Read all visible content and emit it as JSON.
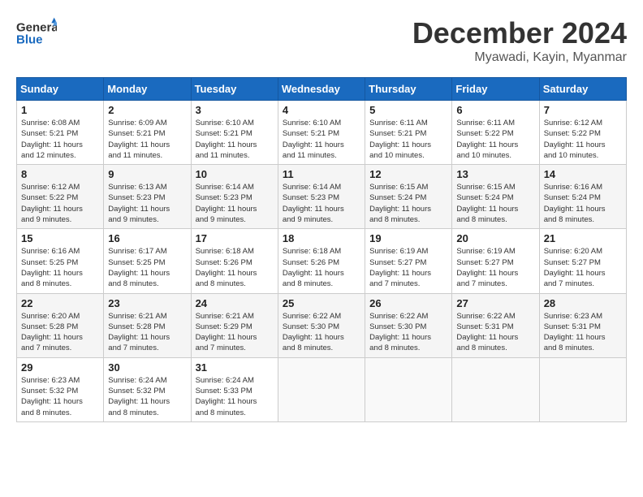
{
  "header": {
    "logo_line1": "General",
    "logo_line2": "Blue",
    "month": "December 2024",
    "location": "Myawadi, Kayin, Myanmar"
  },
  "days_of_week": [
    "Sunday",
    "Monday",
    "Tuesday",
    "Wednesday",
    "Thursday",
    "Friday",
    "Saturday"
  ],
  "weeks": [
    [
      {
        "day": 1,
        "info": "Sunrise: 6:08 AM\nSunset: 5:21 PM\nDaylight: 11 hours\nand 12 minutes."
      },
      {
        "day": 2,
        "info": "Sunrise: 6:09 AM\nSunset: 5:21 PM\nDaylight: 11 hours\nand 11 minutes."
      },
      {
        "day": 3,
        "info": "Sunrise: 6:10 AM\nSunset: 5:21 PM\nDaylight: 11 hours\nand 11 minutes."
      },
      {
        "day": 4,
        "info": "Sunrise: 6:10 AM\nSunset: 5:21 PM\nDaylight: 11 hours\nand 11 minutes."
      },
      {
        "day": 5,
        "info": "Sunrise: 6:11 AM\nSunset: 5:21 PM\nDaylight: 11 hours\nand 10 minutes."
      },
      {
        "day": 6,
        "info": "Sunrise: 6:11 AM\nSunset: 5:22 PM\nDaylight: 11 hours\nand 10 minutes."
      },
      {
        "day": 7,
        "info": "Sunrise: 6:12 AM\nSunset: 5:22 PM\nDaylight: 11 hours\nand 10 minutes."
      }
    ],
    [
      {
        "day": 8,
        "info": "Sunrise: 6:12 AM\nSunset: 5:22 PM\nDaylight: 11 hours\nand 9 minutes."
      },
      {
        "day": 9,
        "info": "Sunrise: 6:13 AM\nSunset: 5:23 PM\nDaylight: 11 hours\nand 9 minutes."
      },
      {
        "day": 10,
        "info": "Sunrise: 6:14 AM\nSunset: 5:23 PM\nDaylight: 11 hours\nand 9 minutes."
      },
      {
        "day": 11,
        "info": "Sunrise: 6:14 AM\nSunset: 5:23 PM\nDaylight: 11 hours\nand 9 minutes."
      },
      {
        "day": 12,
        "info": "Sunrise: 6:15 AM\nSunset: 5:24 PM\nDaylight: 11 hours\nand 8 minutes."
      },
      {
        "day": 13,
        "info": "Sunrise: 6:15 AM\nSunset: 5:24 PM\nDaylight: 11 hours\nand 8 minutes."
      },
      {
        "day": 14,
        "info": "Sunrise: 6:16 AM\nSunset: 5:24 PM\nDaylight: 11 hours\nand 8 minutes."
      }
    ],
    [
      {
        "day": 15,
        "info": "Sunrise: 6:16 AM\nSunset: 5:25 PM\nDaylight: 11 hours\nand 8 minutes."
      },
      {
        "day": 16,
        "info": "Sunrise: 6:17 AM\nSunset: 5:25 PM\nDaylight: 11 hours\nand 8 minutes."
      },
      {
        "day": 17,
        "info": "Sunrise: 6:18 AM\nSunset: 5:26 PM\nDaylight: 11 hours\nand 8 minutes."
      },
      {
        "day": 18,
        "info": "Sunrise: 6:18 AM\nSunset: 5:26 PM\nDaylight: 11 hours\nand 8 minutes."
      },
      {
        "day": 19,
        "info": "Sunrise: 6:19 AM\nSunset: 5:27 PM\nDaylight: 11 hours\nand 7 minutes."
      },
      {
        "day": 20,
        "info": "Sunrise: 6:19 AM\nSunset: 5:27 PM\nDaylight: 11 hours\nand 7 minutes."
      },
      {
        "day": 21,
        "info": "Sunrise: 6:20 AM\nSunset: 5:27 PM\nDaylight: 11 hours\nand 7 minutes."
      }
    ],
    [
      {
        "day": 22,
        "info": "Sunrise: 6:20 AM\nSunset: 5:28 PM\nDaylight: 11 hours\nand 7 minutes."
      },
      {
        "day": 23,
        "info": "Sunrise: 6:21 AM\nSunset: 5:28 PM\nDaylight: 11 hours\nand 7 minutes."
      },
      {
        "day": 24,
        "info": "Sunrise: 6:21 AM\nSunset: 5:29 PM\nDaylight: 11 hours\nand 7 minutes."
      },
      {
        "day": 25,
        "info": "Sunrise: 6:22 AM\nSunset: 5:30 PM\nDaylight: 11 hours\nand 8 minutes."
      },
      {
        "day": 26,
        "info": "Sunrise: 6:22 AM\nSunset: 5:30 PM\nDaylight: 11 hours\nand 8 minutes."
      },
      {
        "day": 27,
        "info": "Sunrise: 6:22 AM\nSunset: 5:31 PM\nDaylight: 11 hours\nand 8 minutes."
      },
      {
        "day": 28,
        "info": "Sunrise: 6:23 AM\nSunset: 5:31 PM\nDaylight: 11 hours\nand 8 minutes."
      }
    ],
    [
      {
        "day": 29,
        "info": "Sunrise: 6:23 AM\nSunset: 5:32 PM\nDaylight: 11 hours\nand 8 minutes."
      },
      {
        "day": 30,
        "info": "Sunrise: 6:24 AM\nSunset: 5:32 PM\nDaylight: 11 hours\nand 8 minutes."
      },
      {
        "day": 31,
        "info": "Sunrise: 6:24 AM\nSunset: 5:33 PM\nDaylight: 11 hours\nand 8 minutes."
      },
      null,
      null,
      null,
      null
    ]
  ]
}
